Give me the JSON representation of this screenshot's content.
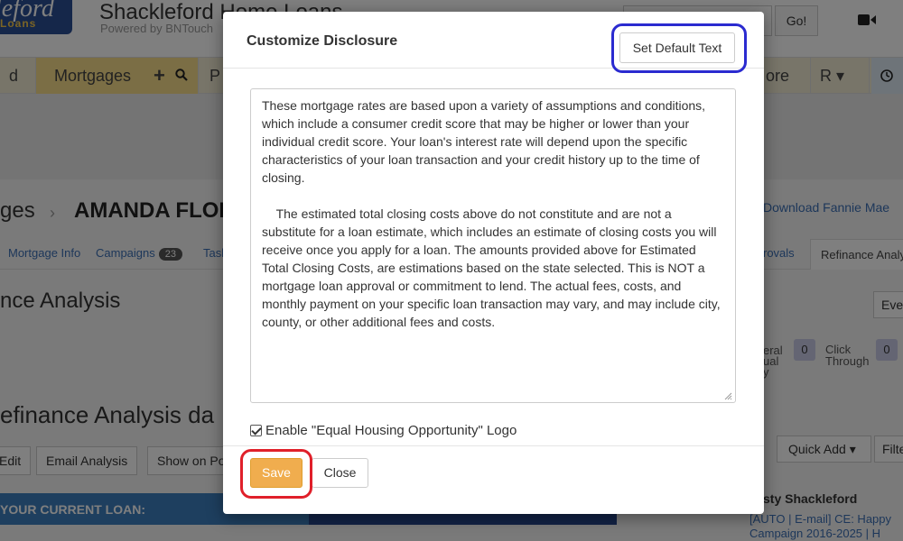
{
  "app": {
    "logo_line1": "leford",
    "logo_line2": "Loans",
    "brand_title": "Shackleford Home Loans",
    "brand_subtitle": "Powered by BNTouch",
    "go_label": "Go!"
  },
  "nav": {
    "left_label": "d",
    "mortgages_label": "Mortgages",
    "plus_label": "+",
    "p_label": "P",
    "more_label": "ore ▾",
    "r_label": "R ▾"
  },
  "breadcrumb": {
    "section": "ges",
    "arrow": "›",
    "name": "AMANDA FLOR",
    "download_link": "Download Fannie Mae"
  },
  "tabs": {
    "mortgage_info": "Mortgage Info",
    "campaigns": "Campaigns",
    "campaigns_count": "23",
    "tasks": "Task",
    "approvals": "rovals",
    "refinance": "Refinance Analy"
  },
  "page": {
    "section_title": "nce Analysis",
    "event_btn": "Eve",
    "refi_title": "efinance Analysis da",
    "edit_btn": "Edit",
    "email_btn": "Email Analysis",
    "show_btn": "Show on Por",
    "quick_add": "Quick Add ▾",
    "filter_btn": "Filte",
    "current_loan": "YOUR CURRENT LOAN:",
    "activity_name": "sty Shackleford",
    "activity_text": "[AUTO | E-mail] CE: Happy Campaign 2016-2025 | H"
  },
  "stats": {
    "referral_label": "eral",
    "referral_sub": "ual",
    "referral_sub2": "y",
    "referral_count": "0",
    "click_label": "Click",
    "click_sub": "Through",
    "click_count": "0"
  },
  "modal": {
    "title": "Customize Disclosure",
    "set_default_label": "Set Default Text",
    "disclosure_text": "These mortgage rates are based upon a variety of assumptions and conditions, which include a consumer credit score that may be higher or lower than your individual credit score. Your loan's interest rate will depend upon the specific characteristics of your loan transaction and your credit history up to the time of closing.\n\n    The estimated total closing costs above do not constitute and are not a substitute for a loan estimate, which includes an estimate of closing costs you will receive once you apply for a loan. The amounts provided above for Estimated Total Closing Costs, are estimations based on the state selected. This is NOT a mortgage loan approval or commitment to lend. The actual fees, costs, and monthly payment on your specific loan transaction may vary, and may include city, county, or other additional fees and costs.",
    "equal_housing_label": "Enable \"Equal Housing Opportunity\" Logo",
    "equal_housing_checked": true,
    "save_label": "Save",
    "close_label": "Close"
  },
  "colors": {
    "save_button": "#f0ad4e",
    "highlight_blue": "#2b2bd0",
    "highlight_red": "#e0202a",
    "nav_active": "#f7dc8a"
  }
}
